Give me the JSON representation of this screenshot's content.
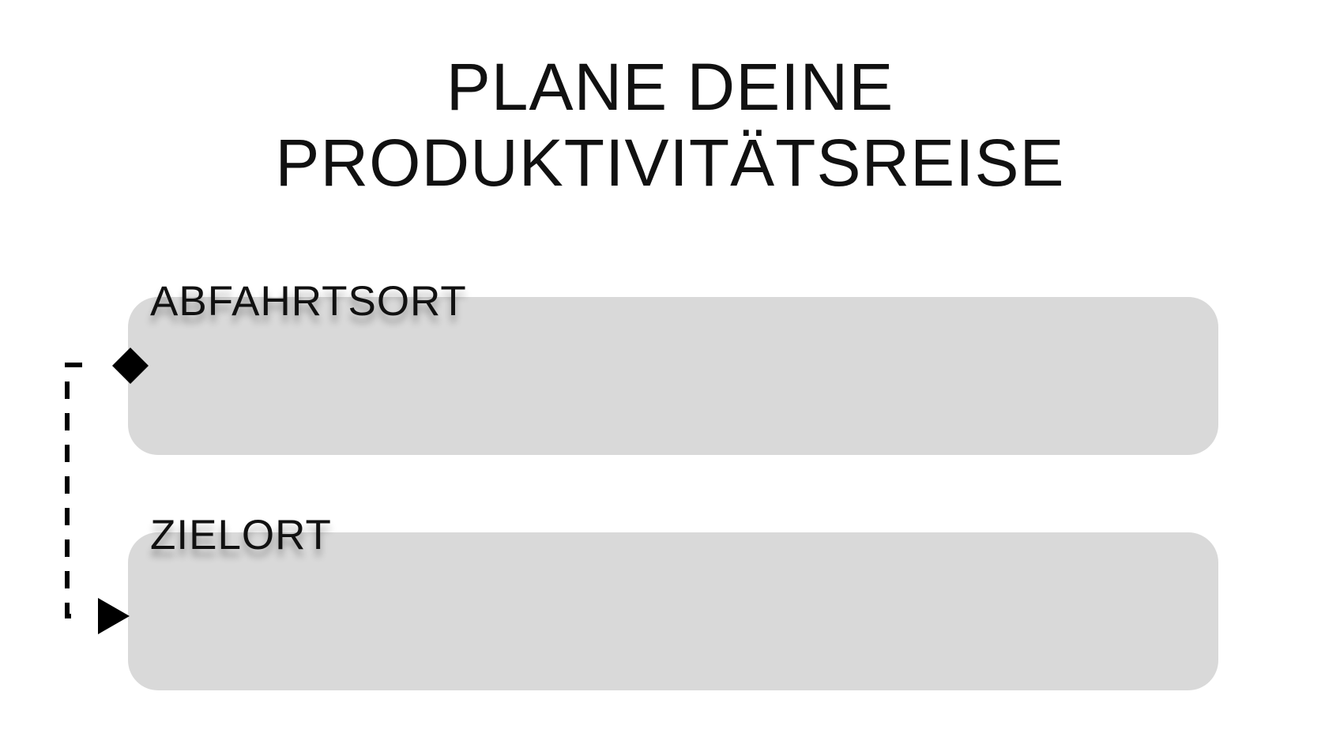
{
  "header": {
    "title_line1": "PLANE DEINE",
    "title_line2": "PRODUKTIVITÄTSREISE"
  },
  "form": {
    "origin": {
      "label": "ABFAHRTSORT",
      "value": "",
      "placeholder": ""
    },
    "destination": {
      "label": "ZIELORT",
      "value": "",
      "placeholder": ""
    }
  },
  "connector": {
    "start_icon": "diamond-icon",
    "end_icon": "arrowhead-icon",
    "line_style": "dashed",
    "color": "#000000"
  },
  "colors": {
    "field_background": "#d9d9d9",
    "text": "#111111",
    "page_background": "#ffffff"
  }
}
